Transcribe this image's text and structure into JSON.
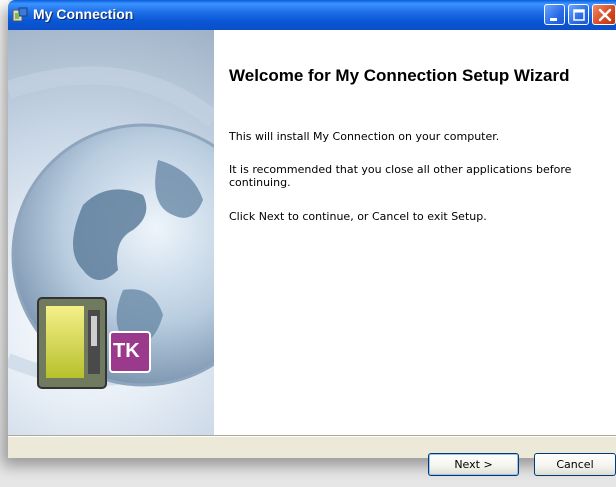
{
  "window": {
    "title": "My Connection"
  },
  "content": {
    "heading": "Welcome for My Connection Setup Wizard",
    "paragraphs": [
      "This will install My Connection on your computer.",
      "It is recommended that you close all other applications before continuing.",
      "Click Next to continue, or Cancel to exit Setup."
    ]
  },
  "sidepanel": {
    "logo_text": "TK"
  },
  "buttons": {
    "next": "Next >",
    "cancel": "Cancel"
  },
  "colors": {
    "titlebar": "#0a56d6",
    "window_bg": "#ece9d8",
    "close_button": "#d8471f"
  }
}
